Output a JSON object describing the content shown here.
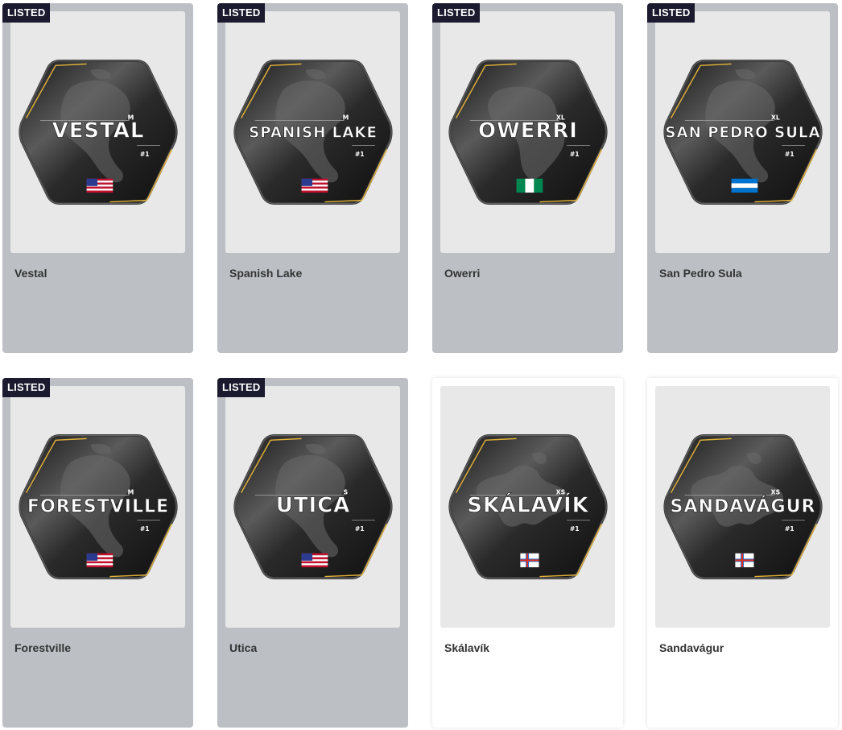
{
  "badge_label": "LISTED",
  "colors": {
    "listed_card_bg": "#bcc0c4",
    "badge_bg": "#1b1a2e",
    "accent_gold": "#e2b23a",
    "art_bg": "#e8e8e9"
  },
  "cards": [
    {
      "name": "Vestal",
      "badge_text": "VESTAL",
      "size": "M",
      "rank": "#1",
      "flag": "us-flag-icon",
      "map": "americas-map",
      "listed": true
    },
    {
      "name": "Spanish Lake",
      "badge_text": "SPANISH LAKE",
      "size": "M",
      "rank": "#1",
      "flag": "us-flag-icon",
      "map": "americas-map",
      "listed": true
    },
    {
      "name": "Owerri",
      "badge_text": "OWERRI",
      "size": "XL",
      "rank": "#1",
      "flag": "nigeria-flag-icon",
      "map": "africa-map",
      "listed": true
    },
    {
      "name": "San Pedro Sula",
      "badge_text": "SAN PEDRO SULA",
      "size": "XL",
      "rank": "#1",
      "flag": "honduras-flag-icon",
      "map": "americas-map",
      "listed": true
    },
    {
      "name": "Forestville",
      "badge_text": "FORESTVILLE",
      "size": "M",
      "rank": "#1",
      "flag": "us-flag-icon",
      "map": "americas-map",
      "listed": true
    },
    {
      "name": "Utica",
      "badge_text": "UTICA",
      "size": "S",
      "rank": "#1",
      "flag": "us-flag-icon",
      "map": "americas-map",
      "listed": true
    },
    {
      "name": "Skálavík",
      "badge_text": "SKÁLAVÍK",
      "size": "XS",
      "rank": "#1",
      "flag": "faroe-flag-icon",
      "map": "europe-map",
      "listed": false
    },
    {
      "name": "Sandavágur",
      "badge_text": "SANDAVÁGUR",
      "size": "XS",
      "rank": "#1",
      "flag": "faroe-flag-icon",
      "map": "europe-map",
      "listed": false
    }
  ]
}
